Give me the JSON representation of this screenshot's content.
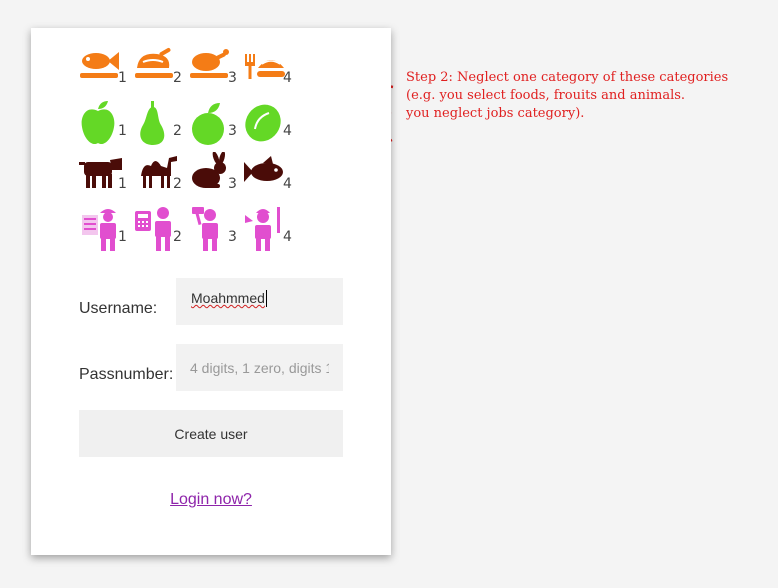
{
  "colors": {
    "foods": "#f47c16",
    "fruits": "#64d826",
    "animals": "#4a0c08",
    "jobs": "#e14ecf",
    "annotation": "#e02020",
    "link": "#8e24aa"
  },
  "categories": [
    {
      "name": "foods",
      "items": [
        {
          "icon": "fish-on-plate-icon",
          "number": "1"
        },
        {
          "icon": "ham-on-plate-icon",
          "number": "2"
        },
        {
          "icon": "roast-chicken-icon",
          "number": "3"
        },
        {
          "icon": "spaghetti-fork-icon",
          "number": "4"
        }
      ]
    },
    {
      "name": "fruits",
      "items": [
        {
          "icon": "apple-icon",
          "number": "1"
        },
        {
          "icon": "pear-icon",
          "number": "2"
        },
        {
          "icon": "round-fruit-icon",
          "number": "3"
        },
        {
          "icon": "lime-icon",
          "number": "4"
        }
      ]
    },
    {
      "name": "animals",
      "items": [
        {
          "icon": "cow-icon",
          "number": "1"
        },
        {
          "icon": "camel-icon",
          "number": "2"
        },
        {
          "icon": "rabbit-icon",
          "number": "3"
        },
        {
          "icon": "fish-icon",
          "number": "4"
        }
      ]
    },
    {
      "name": "jobs",
      "items": [
        {
          "icon": "engineer-icon",
          "number": "1"
        },
        {
          "icon": "accountant-icon",
          "number": "2"
        },
        {
          "icon": "painter-icon",
          "number": "3"
        },
        {
          "icon": "worker-icon",
          "number": "4"
        }
      ]
    }
  ],
  "form": {
    "username_label": "Username:",
    "username_value": "Moahmmed",
    "passnumber_label": "Passnumber:",
    "passnumber_placeholder": "4 digits, 1 zero, digits 1",
    "create_button": "Create user",
    "login_link": "Login now?"
  },
  "annotation": {
    "lines": [
      "Step 2: Neglect one category of these categories",
      "(e.g. you select foods, frouits and animals.",
      "you neglect jobs category)."
    ]
  }
}
